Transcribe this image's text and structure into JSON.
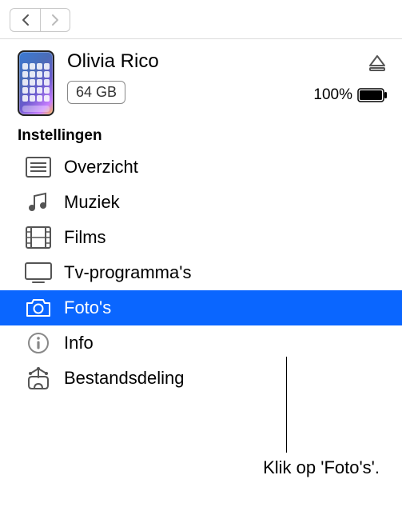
{
  "device": {
    "name": "Olivia Rico",
    "capacity": "64 GB",
    "battery_percent": "100%"
  },
  "sections": {
    "settings_header": "Instellingen"
  },
  "settings": {
    "items": [
      {
        "label": "Overzicht"
      },
      {
        "label": "Muziek"
      },
      {
        "label": "Films"
      },
      {
        "label": "Tv-programma's"
      },
      {
        "label": "Foto's"
      },
      {
        "label": "Info"
      },
      {
        "label": "Bestandsdeling"
      }
    ]
  },
  "callout": {
    "text": "Klik op 'Foto's'."
  }
}
